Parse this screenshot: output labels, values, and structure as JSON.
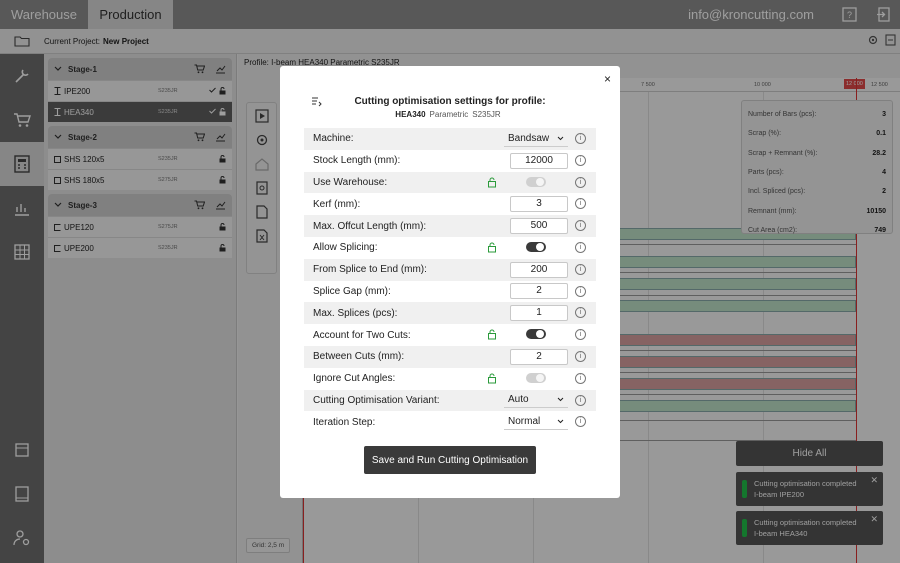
{
  "topbar": {
    "tabs": [
      "Warehouse",
      "Production"
    ],
    "email": "info@kroncutting.com"
  },
  "project": {
    "label": "Current Project:",
    "name": "New Project"
  },
  "tree": {
    "stages": [
      {
        "name": "Stage-1",
        "profiles": [
          {
            "name": "IPE200",
            "grade": "S235JR"
          },
          {
            "name": "HEA340",
            "grade": "S235JR"
          }
        ]
      },
      {
        "name": "Stage-2",
        "profiles": [
          {
            "name": "SHS 120x5",
            "grade": "S235JR"
          },
          {
            "name": "SHS 180x5",
            "grade": "S275JR"
          }
        ]
      },
      {
        "name": "Stage-3",
        "profiles": [
          {
            "name": "UPE120",
            "grade": "S275JR"
          },
          {
            "name": "UPE200",
            "grade": "S235JR"
          }
        ]
      }
    ]
  },
  "main": {
    "profile_line": "Profile: I-beam HEA340 Parametric S235JR",
    "ruler": [
      "7 500",
      "10 000",
      "12 000",
      "12 500"
    ],
    "grid_label": "Grid: 2,5 m",
    "stats": [
      {
        "label": "Number of Bars (pcs):",
        "value": "3"
      },
      {
        "label": "Scrap (%):",
        "value": "0.1"
      },
      {
        "label": "Scrap + Remnant (%):",
        "value": "28.2"
      },
      {
        "label": "Parts (pcs):",
        "value": "4"
      },
      {
        "label": "Incl. Spliced (pcs):",
        "value": "2"
      },
      {
        "label": "Remnant (mm):",
        "value": "10150"
      },
      {
        "label": "Cut Area (cm2):",
        "value": "749"
      }
    ]
  },
  "toasts": {
    "hide_all": "Hide All",
    "items": [
      {
        "line1": "Cutting optimisation completed",
        "line2": "I-beam IPE200"
      },
      {
        "line1": "Cutting optimisation completed",
        "line2": "I-beam HEA340"
      }
    ]
  },
  "modal": {
    "title": "Cutting optimisation settings for profile:",
    "profile": "HEA340",
    "variant": "Parametric",
    "grade": "S235JR",
    "close": "×",
    "rows": [
      {
        "label": "Machine:",
        "select": "Bandsaw"
      },
      {
        "label": "Stock Length (mm):",
        "value": "12000"
      },
      {
        "label": "Use Warehouse:",
        "toggle": false
      },
      {
        "label": "Kerf (mm):",
        "value": "3"
      },
      {
        "label": "Max. Offcut Length (mm):",
        "value": "500"
      },
      {
        "label": "Allow Splicing:",
        "toggle": true
      },
      {
        "label": "From Splice to End (mm):",
        "value": "200"
      },
      {
        "label": "Splice Gap (mm):",
        "value": "2"
      },
      {
        "label": "Max. Splices (pcs):",
        "value": "1"
      },
      {
        "label": "Account for Two Cuts:",
        "toggle": true
      },
      {
        "label": "Between Cuts (mm):",
        "value": "2"
      },
      {
        "label": "Ignore Cut Angles:",
        "toggle": false
      },
      {
        "label": "Cutting Optimisation Variant:",
        "select": "Auto"
      },
      {
        "label": "Iteration Step:",
        "select": "Normal"
      }
    ],
    "save_label": "Save and Run Cutting Optimisation"
  }
}
